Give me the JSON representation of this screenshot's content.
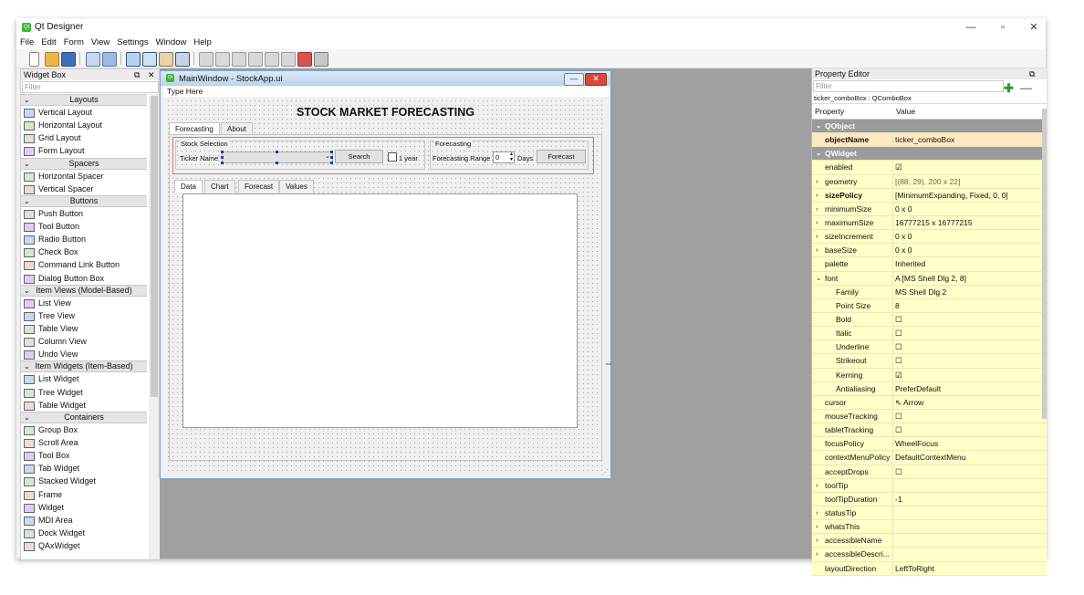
{
  "app": {
    "title": "Qt Designer",
    "minimize": "—",
    "restore": "▫",
    "close": "✕"
  },
  "menu": [
    "File",
    "Edit",
    "Form",
    "View",
    "Settings",
    "Window",
    "Help"
  ],
  "widget_box": {
    "title": "Widget Box",
    "filter_placeholder": "Filter",
    "sections": [
      {
        "name": "Layouts",
        "items": [
          "Vertical Layout",
          "Horizontal Layout",
          "Grid Layout",
          "Form Layout"
        ]
      },
      {
        "name": "Spacers",
        "items": [
          "Horizontal Spacer",
          "Vertical Spacer"
        ]
      },
      {
        "name": "Buttons",
        "items": [
          "Push Button",
          "Tool Button",
          "Radio Button",
          "Check Box",
          "Command Link Button",
          "Dialog Button Box"
        ]
      },
      {
        "name": "Item Views (Model-Based)",
        "items": [
          "List View",
          "Tree View",
          "Table View",
          "Column View",
          "Undo View"
        ]
      },
      {
        "name": "Item Widgets (Item-Based)",
        "items": [
          "List Widget",
          "Tree Widget",
          "Table Widget"
        ]
      },
      {
        "name": "Containers",
        "items": [
          "Group Box",
          "Scroll Area",
          "Tool Box",
          "Tab Widget",
          "Stacked Widget",
          "Frame",
          "Widget",
          "MDI Area",
          "Dock Widget",
          "QAxWidget"
        ]
      }
    ]
  },
  "form": {
    "window_title": "MainWindow - StockApp.ui",
    "type_here": "Type Here",
    "heading": "STOCK MARKET FORECASTING",
    "outer_tabs": [
      "Forecasting",
      "About"
    ],
    "stock_group_title": "Stock Selection",
    "ticker_label": "Ticker Name",
    "search_button": "Search",
    "one_year_label": "1 year",
    "forecast_group_title": "Forecasting",
    "range_label": "Forecasting Range",
    "range_value": "0",
    "days_label": "Days",
    "forecast_button": "Forecast",
    "inner_tabs": [
      "Data",
      "Chart",
      "Forecast",
      "Values"
    ]
  },
  "property_editor": {
    "title": "Property Editor",
    "filter_placeholder": "Filter",
    "object_line": "ticker_comboBox : QComboBox",
    "col_property": "Property",
    "col_value": "Value",
    "rows": [
      {
        "name": "QObject",
        "value": "",
        "type": "cat"
      },
      {
        "name": "objectName",
        "value": "ticker_comboBox",
        "type": "bold"
      },
      {
        "name": "QWidget",
        "value": "",
        "type": "cat"
      },
      {
        "name": "enabled",
        "value": "☑",
        "type": "normal"
      },
      {
        "name": "geometry",
        "value": "[(88, 29), 200 x 22]",
        "type": "expand"
      },
      {
        "name": "sizePolicy",
        "value": "[MinimumExpanding, Fixed, 0, 0]",
        "type": "expandbold"
      },
      {
        "name": "minimumSize",
        "value": "0 x 0",
        "type": "expand"
      },
      {
        "name": "maximumSize",
        "value": "16777215 x 16777215",
        "type": "expand"
      },
      {
        "name": "sizeIncrement",
        "value": "0 x 0",
        "type": "expand"
      },
      {
        "name": "baseSize",
        "value": "0 x 0",
        "type": "expand"
      },
      {
        "name": "palette",
        "value": "Inherited",
        "type": "normal"
      },
      {
        "name": "font",
        "value": "A  [MS Shell Dlg 2, 8]",
        "type": "open"
      },
      {
        "name": "Family",
        "value": "MS Shell Dlg 2",
        "type": "sub"
      },
      {
        "name": "Point Size",
        "value": "8",
        "type": "sub"
      },
      {
        "name": "Bold",
        "value": "☐",
        "type": "sub"
      },
      {
        "name": "Italic",
        "value": "☐",
        "type": "sub"
      },
      {
        "name": "Underline",
        "value": "☐",
        "type": "sub"
      },
      {
        "name": "Strikeout",
        "value": "☐",
        "type": "sub"
      },
      {
        "name": "Kerning",
        "value": "☑",
        "type": "sub"
      },
      {
        "name": "Antialiasing",
        "value": "PreferDefault",
        "type": "sub"
      },
      {
        "name": "cursor",
        "value": "⇖  Arrow",
        "type": "normal"
      },
      {
        "name": "mouseTracking",
        "value": "☐",
        "type": "normal"
      },
      {
        "name": "tabletTracking",
        "value": "☐",
        "type": "normal"
      },
      {
        "name": "focusPolicy",
        "value": "WheelFocus",
        "type": "normal"
      },
      {
        "name": "contextMenuPolicy",
        "value": "DefaultContextMenu",
        "type": "normal"
      },
      {
        "name": "acceptDrops",
        "value": "☐",
        "type": "normal"
      },
      {
        "name": "toolTip",
        "value": "",
        "type": "expand"
      },
      {
        "name": "toolTipDuration",
        "value": "-1",
        "type": "normal"
      },
      {
        "name": "statusTip",
        "value": "",
        "type": "expand"
      },
      {
        "name": "whatsThis",
        "value": "",
        "type": "expand"
      },
      {
        "name": "accessibleName",
        "value": "",
        "type": "expand"
      },
      {
        "name": "accessibleDescri...",
        "value": "",
        "type": "expand"
      },
      {
        "name": "layoutDirection",
        "value": "LeftToRight",
        "type": "normal"
      }
    ]
  },
  "colors": {
    "accent": "#6c93c9",
    "property_row_bg": "#ffffc8",
    "category_bg": "#9b9b9b"
  }
}
